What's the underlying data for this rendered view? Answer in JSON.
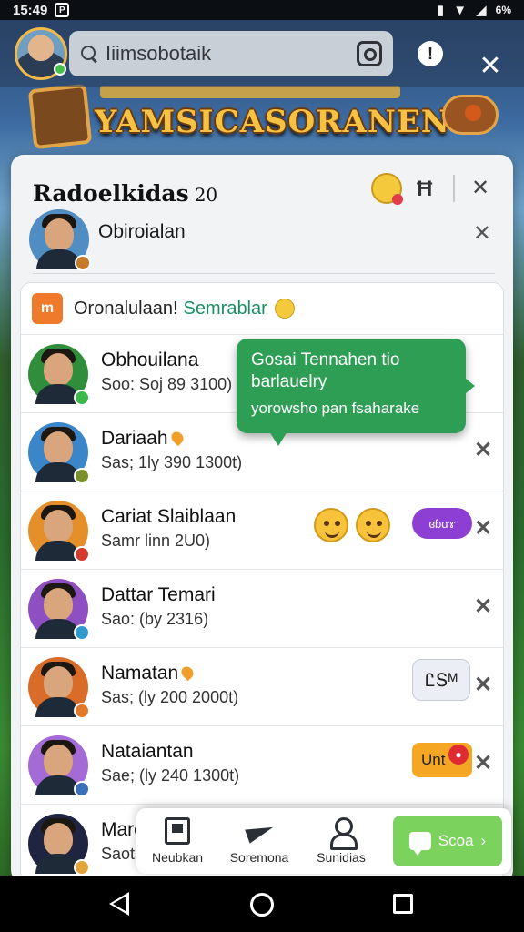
{
  "status_bar": {
    "time": "15:49",
    "notif": "P",
    "battery": "6%"
  },
  "search": {
    "value": "Iiimsobotaik"
  },
  "top": {
    "alert_glyph": "!",
    "close_glyph": "✕"
  },
  "game": {
    "title": "YAMSICASORANEN"
  },
  "panel": {
    "title": "Radoelkidas",
    "count": "20",
    "hash_glyph": "Ħ",
    "close_glyph": "✕",
    "profile_name": "Obiroialan",
    "chevron": "✕"
  },
  "list": {
    "header_label": "Oronalulaan!",
    "header_highlight": "Semrablar",
    "header_badge": "m",
    "rows": [
      {
        "name": "Obhouilana",
        "sub": "Soo: Soj 89 3100)",
        "mini_color": "#3db84b",
        "bg": "#2f8d3c"
      },
      {
        "name": "Dariaah",
        "sub": "Sas; 1ly 390 1300t)",
        "mini_color": "#7a8f2a",
        "bg": "#3a86c9"
      },
      {
        "name": "Cariat Slaiblaan",
        "sub": "Samr linn 2U0)",
        "mini_color": "#d23b2e",
        "bg": "#e58f2a"
      },
      {
        "name": "Dattar Temari",
        "sub": "Sao: (by 2316)",
        "mini_color": "#2f9acb",
        "bg": "#8e4fc2"
      },
      {
        "name": "Namatan",
        "sub": "Sas; (ly 200 2000t)",
        "mini_color": "#e07a2a",
        "bg": "#d96c28"
      },
      {
        "name": "Nataiantan",
        "sub": "Sae; (ly 240 1300t)",
        "mini_color": "#3b6fb8",
        "bg": "#a46ad6"
      },
      {
        "name": "Marc",
        "sub": "Saota",
        "mini_color": "#e4a43c",
        "bg": "#1f2440"
      }
    ],
    "close_glyph": "✕",
    "purple_pill": "ɞɓɑɤ",
    "white_bubble": "ᏝՏᴹ",
    "orange_bubble": "Unt"
  },
  "tooltip": {
    "line1": "Gosai Tennahen tio",
    "line2": "barlauelry",
    "line3": "yorowsho pan fsaharake"
  },
  "bottom_nav": {
    "items": [
      "Neubkan",
      "Soremona",
      "Sunidias"
    ],
    "cta_label": "Scoa",
    "cta_arrow": "›"
  }
}
